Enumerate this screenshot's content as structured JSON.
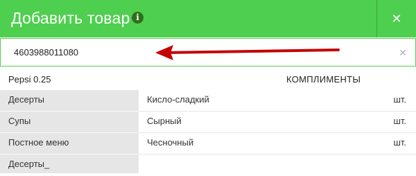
{
  "header": {
    "title": "Добавить товар",
    "info_icon": "info-icon",
    "close_symbol": "✕",
    "accent_color": "#4fcf4f"
  },
  "barcode": {
    "value": "4603988011080",
    "clear_symbol": "✕"
  },
  "annotation": {
    "arrow_color": "#c40000"
  },
  "product": {
    "name": "Pepsi 0.25",
    "section": "КОМПЛИМЕНТЫ"
  },
  "categories": [
    {
      "label": "Десерты"
    },
    {
      "label": "Супы"
    },
    {
      "label": "Постное меню"
    },
    {
      "label": "Десерты_"
    }
  ],
  "options": [
    {
      "name": "Кисло-сладкий",
      "unit": "шт."
    },
    {
      "name": "Сырный",
      "unit": "шт."
    },
    {
      "name": "Чесночный",
      "unit": "шт."
    }
  ]
}
